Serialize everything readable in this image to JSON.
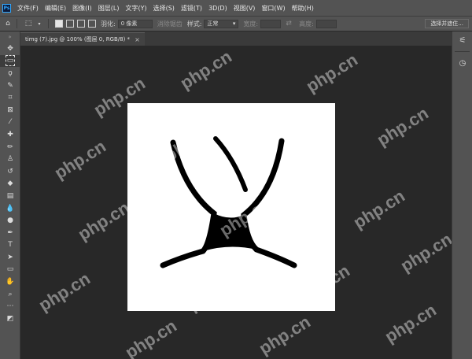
{
  "app": {
    "logo_text": "Ps"
  },
  "menu": [
    "文件(F)",
    "编辑(E)",
    "图像(I)",
    "图层(L)",
    "文字(Y)",
    "选择(S)",
    "滤镜(T)",
    "3D(D)",
    "视图(V)",
    "窗口(W)",
    "帮助(H)"
  ],
  "options_bar": {
    "feather_label": "羽化:",
    "feather_value": "0 像素",
    "antialias_label": "消除锯齿",
    "style_label": "样式:",
    "style_value": "正常",
    "width_label": "宽度:",
    "height_label": "高度:",
    "select_mask_button": "选择并遮住..."
  },
  "document": {
    "tab_title": "timg (7).jpg @ 100% (图层 0, RGB/8) *",
    "close_glyph": "×"
  },
  "tools": [
    {
      "name": "move-tool",
      "glyph": "✥"
    },
    {
      "name": "marquee-tool",
      "glyph": "▭"
    },
    {
      "name": "lasso-tool",
      "glyph": "ϙ"
    },
    {
      "name": "quick-select-tool",
      "glyph": "✎"
    },
    {
      "name": "crop-tool",
      "glyph": "⌗"
    },
    {
      "name": "frame-tool",
      "glyph": "⊠"
    },
    {
      "name": "eyedropper-tool",
      "glyph": "⁄"
    },
    {
      "name": "healing-brush-tool",
      "glyph": "✚"
    },
    {
      "name": "brush-tool",
      "glyph": "✏"
    },
    {
      "name": "clone-stamp-tool",
      "glyph": "♙"
    },
    {
      "name": "history-brush-tool",
      "glyph": "↺"
    },
    {
      "name": "eraser-tool",
      "glyph": "◆"
    },
    {
      "name": "gradient-tool",
      "glyph": "▤"
    },
    {
      "name": "blur-tool",
      "glyph": "💧"
    },
    {
      "name": "dodge-tool",
      "glyph": "●"
    },
    {
      "name": "pen-tool",
      "glyph": "✒"
    },
    {
      "name": "type-tool",
      "glyph": "T"
    },
    {
      "name": "path-select-tool",
      "glyph": "➤"
    },
    {
      "name": "rectangle-tool",
      "glyph": "▭"
    },
    {
      "name": "hand-tool",
      "glyph": "✋"
    },
    {
      "name": "zoom-tool",
      "glyph": "⌕"
    },
    {
      "name": "edit-toolbar",
      "glyph": "⋯"
    },
    {
      "name": "color-swatches",
      "glyph": "◩"
    }
  ],
  "right_panel_icons": [
    {
      "name": "properties-icon",
      "glyph": "⚟"
    },
    {
      "name": "history-icon",
      "glyph": "◷"
    }
  ],
  "watermark_text": "php.cn"
}
